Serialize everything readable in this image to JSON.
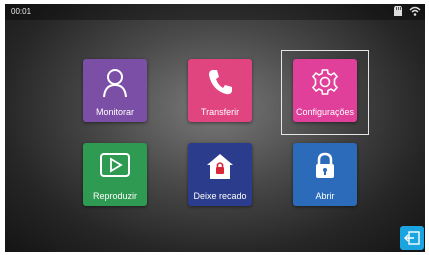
{
  "statusbar": {
    "time": "00:01",
    "icons": [
      "sd-card-icon",
      "wifi-icon"
    ]
  },
  "menu": {
    "items": [
      {
        "label": "Monitorar",
        "icon": "person-icon",
        "color": "#7b4fa5"
      },
      {
        "label": "Transferir",
        "icon": "phone-icon",
        "color": "#e0457f"
      },
      {
        "label": "Configurações",
        "icon": "gear-icon",
        "color": "#e0409a",
        "selected": true
      },
      {
        "label": "Reproduzir",
        "icon": "play-screen-icon",
        "color": "#2f9a52"
      },
      {
        "label": "Deixe recado",
        "icon": "house-lock-icon",
        "color": "#2b3c8c"
      },
      {
        "label": "Abrir",
        "icon": "lock-icon",
        "color": "#2c6bb9"
      }
    ]
  },
  "exit_button": {
    "icon": "exit-icon",
    "color": "#1aa4e0"
  }
}
